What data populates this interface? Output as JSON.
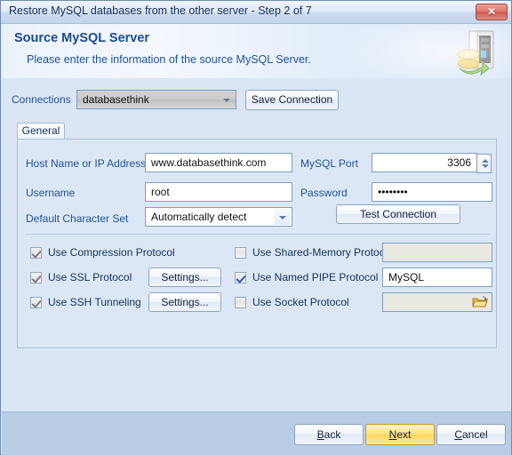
{
  "window": {
    "title": "Restore MySQL databases from the other server - Step 2 of 7",
    "close_label": "✕",
    "close_icon": "close-icon"
  },
  "header": {
    "title": "Source MySQL Server",
    "subtitle": "Please enter the information of the source MySQL Server.",
    "icon": "database-server-restore-icon"
  },
  "connections": {
    "label": "Connections",
    "selected": "databasethink",
    "save_button": "Save Connection"
  },
  "tabs": [
    {
      "label": "General",
      "selected": true
    }
  ],
  "form": {
    "host_label": "Host Name or IP Address",
    "host_value": "www.databasethink.com",
    "port_label": "MySQL Port",
    "port_value": "3306",
    "username_label": "Username",
    "username_value": "root",
    "password_label": "Password",
    "password_value": "••••••••",
    "charset_label": "Default Character Set",
    "charset_value": "Automatically detect",
    "test_button": "Test Connection"
  },
  "options": {
    "left": [
      {
        "label": "Use Compression Protocol",
        "checked": true,
        "style": "gray",
        "button": null
      },
      {
        "label": "Use SSL Protocol",
        "checked": true,
        "style": "gray",
        "button": "Settings..."
      },
      {
        "label": "Use SSH Tunneling",
        "checked": true,
        "style": "gray",
        "button": "Settings..."
      }
    ],
    "right": [
      {
        "label": "Use Shared-Memory Protocol",
        "checked": false,
        "style": "gray",
        "field_value": "",
        "field_readonly": true,
        "has_browse": false
      },
      {
        "label": "Use Named PIPE Protocol",
        "checked": true,
        "style": "blue",
        "field_value": "MySQL",
        "field_readonly": false,
        "has_browse": false
      },
      {
        "label": "Use Socket Protocol",
        "checked": false,
        "style": "gray",
        "field_value": "",
        "field_readonly": true,
        "has_browse": true,
        "browse_icon": "folder-open-icon"
      }
    ]
  },
  "footer": {
    "back": "Back",
    "back_mnemonic": "B",
    "next": "Next",
    "next_mnemonic": "N",
    "cancel": "Cancel",
    "cancel_mnemonic": "C"
  },
  "colors": {
    "accent": "#1e5396",
    "background": "#dbe6f4",
    "footer": "#b9cde6",
    "next_highlight": "#ffd65c",
    "close_red": "#cf5b4e"
  }
}
